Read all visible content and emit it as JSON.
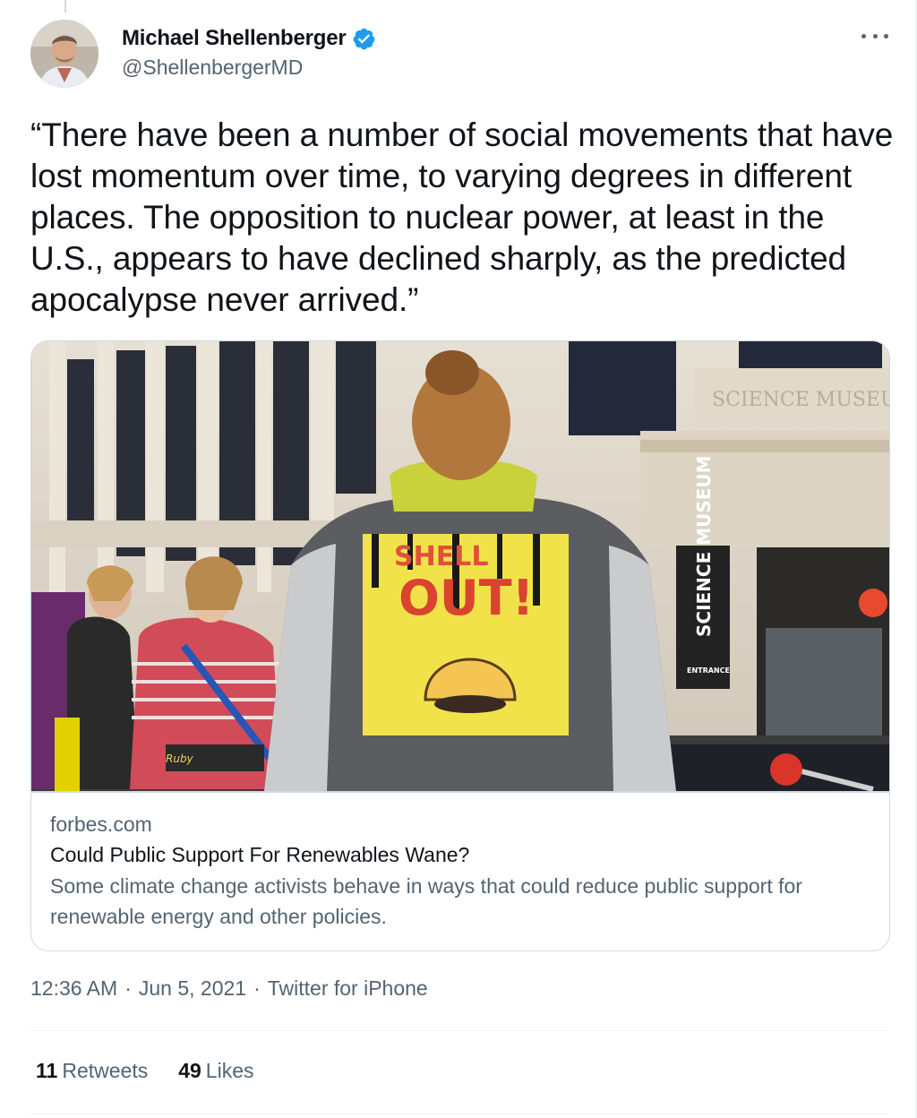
{
  "author": {
    "name": "Michael Shellenberger",
    "handle": "@ShellenbergerMD",
    "verified": true
  },
  "tweet": {
    "text": "“There have been a number of social movements that have lost momentum over time, to varying degrees in different places. The opposition to nuclear power, at least in the U.S., appears to have declined sharply, as the predicted apocalypse never arrived.”"
  },
  "card": {
    "image_text": {
      "building_sign": "SCIENCE MUSEUM",
      "facade_lettering": "SCIENCE MUSEU",
      "entrance_sign": "ENTRANCE",
      "vest_line1": "SHELL",
      "vest_line2": "OUT!",
      "tag": "Ruby"
    },
    "domain": "forbes.com",
    "title": "Could Public Support For Renewables Wane?",
    "description": "Some climate change activists behave in ways that could reduce public support for renewable energy and other policies."
  },
  "meta": {
    "time": "12:36 AM",
    "date": "Jun 5, 2021",
    "source": "Twitter for iPhone",
    "separator": "·"
  },
  "stats": {
    "retweets_count": "11",
    "retweets_label": "Retweets",
    "likes_count": "49",
    "likes_label": "Likes"
  },
  "icons": [
    "verified-badge-icon",
    "more-options-icon"
  ],
  "colors": {
    "verified": "#1d9bf0",
    "secondary_text": "#536471",
    "border": "#cfd9de"
  }
}
